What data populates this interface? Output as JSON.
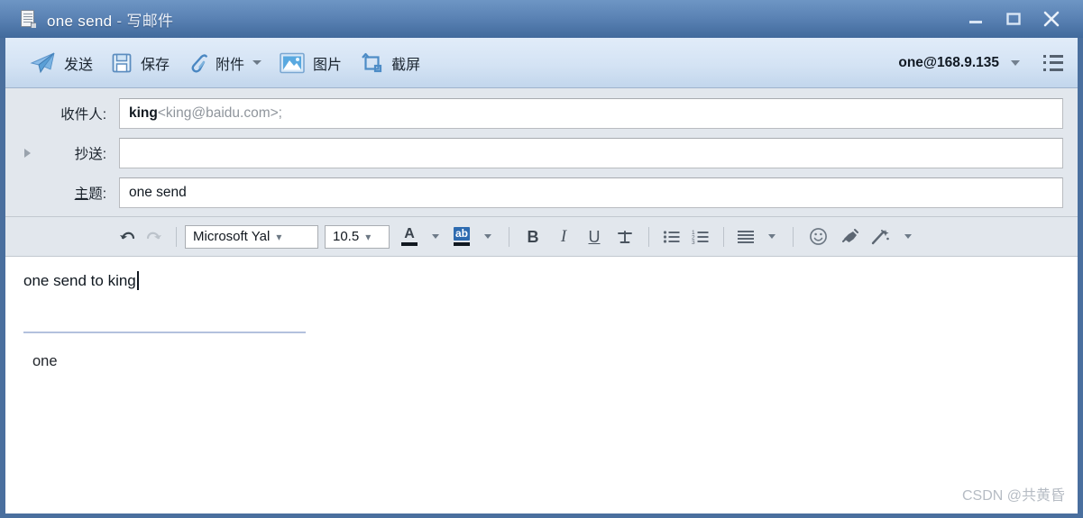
{
  "window": {
    "title_main": "one send",
    "title_dash": "-",
    "title_sub": "写邮件",
    "icon": "document-icon",
    "buttons": {
      "minimize": "minimize-button",
      "maximize": "maximize-button",
      "close": "close-button"
    },
    "colors": {
      "titlebar_top": "#6e96c4",
      "titlebar_bottom": "#416a9c",
      "window_border": "#4a6f9e",
      "toolbar_top": "#e1ecf9",
      "toolbar_bottom": "#c2d6ec",
      "header_bg": "#e2e7ed",
      "divider": "#b3c1dd",
      "accent_blue": "#2e6bb0"
    }
  },
  "toolbar": {
    "items": [
      {
        "label": "发送",
        "icon": "paper-plane-icon",
        "has_caret": false
      },
      {
        "label": "保存",
        "icon": "floppy-disk-icon",
        "has_caret": false
      },
      {
        "label": "附件",
        "icon": "paperclip-icon",
        "has_caret": true
      },
      {
        "label": "图片",
        "icon": "picture-icon",
        "has_caret": false
      },
      {
        "label": "截屏",
        "icon": "screenshot-crop-icon",
        "has_caret": false
      }
    ],
    "account": "one@168.9.135",
    "account_caret": "chevron-down-icon",
    "menu_icon": "list-menu-icon"
  },
  "headers": {
    "to": {
      "label": "收件人:",
      "name": "king",
      "address": "<king@baidu.com>;",
      "placeholder": ""
    },
    "cc": {
      "label": "抄送:",
      "value": "",
      "placeholder": "",
      "expander": "expand-triangle-icon"
    },
    "subject": {
      "label_underlined": "主",
      "label_rest": "题:",
      "value": "one send",
      "placeholder": ""
    }
  },
  "formatbar": {
    "undo": "undo-arrow-icon",
    "redo": "redo-arrow-icon",
    "font_name": "Microsoft Yal",
    "font_size": "10.5",
    "font_color": {
      "glyph": "A",
      "icon": "font-color-icon",
      "caret": true
    },
    "highlight": {
      "glyph": "ab",
      "icon": "highlight-color-icon",
      "caret": true
    },
    "bold": "B",
    "italic": "I",
    "underline": "U",
    "strikethrough": "strikethrough-icon",
    "bullet_list": "bullet-list-icon",
    "numbered_list": "numbered-list-icon",
    "align": {
      "icon": "align-paragraph-icon",
      "caret": true
    },
    "emoji": "emoji-smiley-icon",
    "stamp": "stamp-icon",
    "effects": {
      "icon": "magic-wand-icon",
      "caret": true
    }
  },
  "body": {
    "line1": "one send to king",
    "signature_divider": true,
    "signature": "one"
  },
  "watermark": "CSDN @共黄昏"
}
